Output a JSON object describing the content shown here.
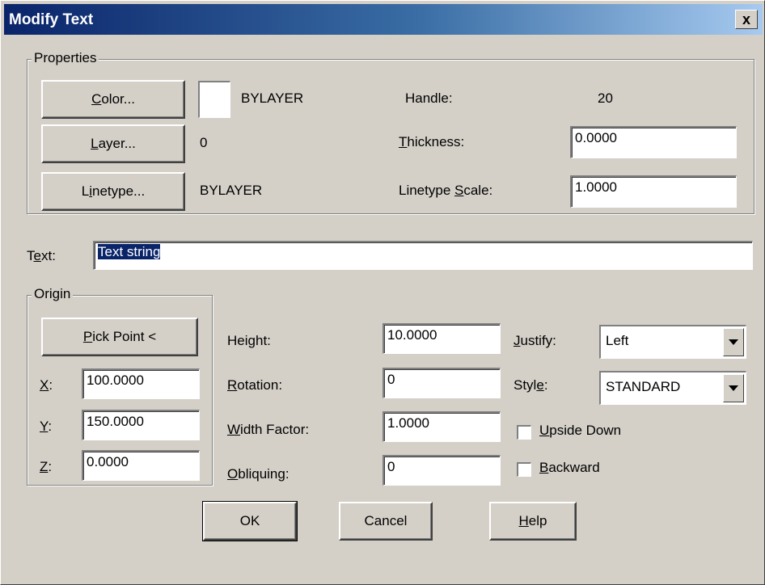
{
  "window": {
    "title": "Modify Text",
    "close_glyph": "x"
  },
  "properties": {
    "legend": "Properties",
    "color_button": {
      "pre": "",
      "key": "C",
      "post": "olor..."
    },
    "color_value": "BYLAYER",
    "layer_button": {
      "pre": "",
      "key": "L",
      "post": "ayer..."
    },
    "layer_value": "0",
    "linetype_button": {
      "pre": "L",
      "key": "i",
      "post": "netype..."
    },
    "linetype_value": "BYLAYER",
    "handle_label": "Handle:",
    "handle_value": "20",
    "thickness_label": {
      "pre": "",
      "key": "T",
      "post": "hickness:"
    },
    "thickness_value": "0.0000",
    "ltscale_label": {
      "pre": "Linetype ",
      "key": "S",
      "post": "cale:"
    },
    "ltscale_value": "1.0000"
  },
  "text": {
    "label": {
      "pre": "T",
      "key": "e",
      "post": "xt:"
    },
    "value": "Text string"
  },
  "origin": {
    "legend": "Origin",
    "pick_button": {
      "pre": "",
      "key": "P",
      "post": "ick Point <"
    },
    "x_label": {
      "pre": "",
      "key": "X",
      "post": ":"
    },
    "x_value": "100.0000",
    "y_label": {
      "pre": "",
      "key": "Y",
      "post": ":"
    },
    "y_value": "150.0000",
    "z_label": {
      "pre": "",
      "key": "Z",
      "post": ":"
    },
    "z_value": "0.0000"
  },
  "params": {
    "height_label": {
      "pre": "Hei",
      "key": "g",
      "post": "ht:"
    },
    "height_value": "10.0000",
    "rotation_label": {
      "pre": "",
      "key": "R",
      "post": "otation:"
    },
    "rotation_value": "0",
    "width_label": {
      "pre": "",
      "key": "W",
      "post": "idth Factor:"
    },
    "width_value": "1.0000",
    "obliquing_label": {
      "pre": "",
      "key": "O",
      "post": "bliquing:"
    },
    "obliquing_value": "0",
    "justify_label": {
      "pre": "",
      "key": "J",
      "post": "ustify:"
    },
    "justify_value": "Left",
    "style_label": {
      "pre": "Styl",
      "key": "e",
      "post": ":"
    },
    "style_value": "STANDARD",
    "upside_label": {
      "pre": "",
      "key": "U",
      "post": "pside Down"
    },
    "upside_checked": false,
    "backward_label": {
      "pre": "",
      "key": "B",
      "post": "ackward"
    },
    "backward_checked": false
  },
  "footer": {
    "ok": "OK",
    "cancel": "Cancel",
    "help": {
      "pre": "",
      "key": "H",
      "post": "elp"
    }
  }
}
